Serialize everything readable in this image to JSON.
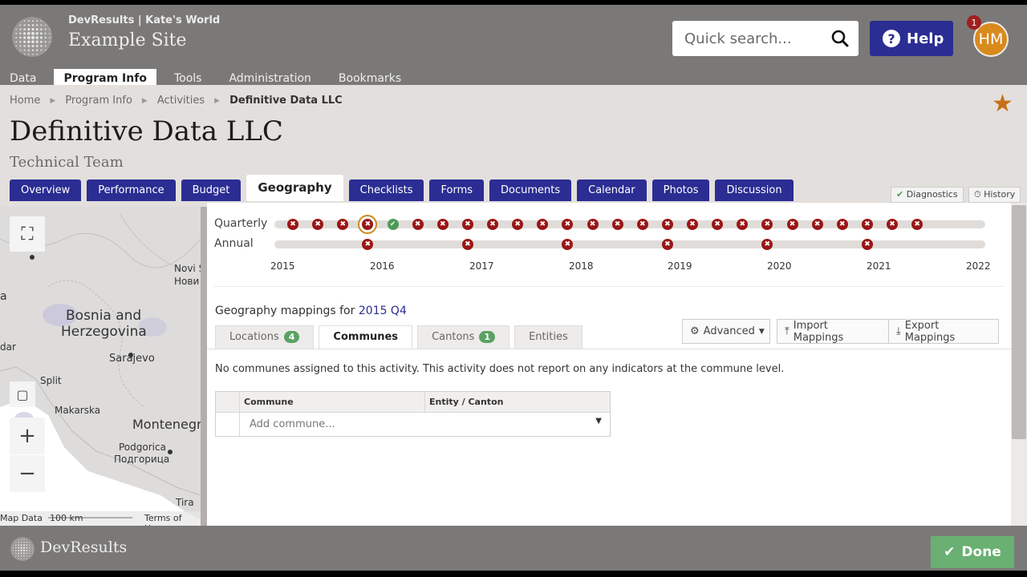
{
  "header": {
    "org": "DevResults",
    "workspace": "Kate's World",
    "site_title": "Example Site",
    "search_placeholder": "Quick search...",
    "help_label": "Help",
    "avatar_initials": "HM",
    "notification_count": "1"
  },
  "mainnav": [
    "Data",
    "Program Info",
    "Tools",
    "Administration",
    "Bookmarks"
  ],
  "breadcrumb": [
    "Home",
    "Program Info",
    "Activities",
    "Definitive Data LLC"
  ],
  "page": {
    "title": "Definitive Data LLC",
    "subtitle": "Technical Team"
  },
  "tabs": [
    "Overview",
    "Performance",
    "Budget",
    "Geography",
    "Checklists",
    "Forms",
    "Documents",
    "Calendar",
    "Photos",
    "Discussion"
  ],
  "side_buttons": {
    "diagnostics": "Diagnostics",
    "history": "History"
  },
  "map": {
    "labels": [
      "Bosnia and",
      "Herzegovina",
      "Sarajevo",
      "Split",
      "Makarska",
      "Montenegr",
      "Podgorica",
      "Подгорица",
      "Novi S",
      "Нови",
      "Tira",
      "dar",
      "a"
    ],
    "footer": {
      "data": "Map Data",
      "scale": "100 km",
      "terms": "Terms of Use"
    }
  },
  "timeline": {
    "quarterly_label": "Quarterly",
    "annual_label": "Annual",
    "years": [
      "2015",
      "2016",
      "2017",
      "2018",
      "2019",
      "2020",
      "2021",
      "2022"
    ]
  },
  "geography": {
    "heading_prefix": "Geography mappings for",
    "period": "2015 Q4",
    "subtabs": [
      {
        "label": "Locations",
        "badge": "4"
      },
      {
        "label": "Communes",
        "badge": ""
      },
      {
        "label": "Cantons",
        "badge": "1"
      },
      {
        "label": "Entities",
        "badge": ""
      }
    ],
    "advanced_label": "Advanced",
    "import_label": "Import Mappings",
    "export_label": "Export Mappings",
    "message": "No communes assigned to this activity. This activity does not report on any indicators at the commune level.",
    "grid": {
      "col_commune": "Commune",
      "col_entity": "Entity / Canton",
      "add_placeholder": "Add commune..."
    }
  },
  "footer": {
    "brand": "DevResults",
    "done_label": "Done"
  },
  "colors": {
    "nav_blue": "#2b2d93",
    "dot_red": "#9a1616",
    "dot_green": "#4c9a56",
    "accent_orange": "#c86f15",
    "done_green": "#6ab072"
  }
}
